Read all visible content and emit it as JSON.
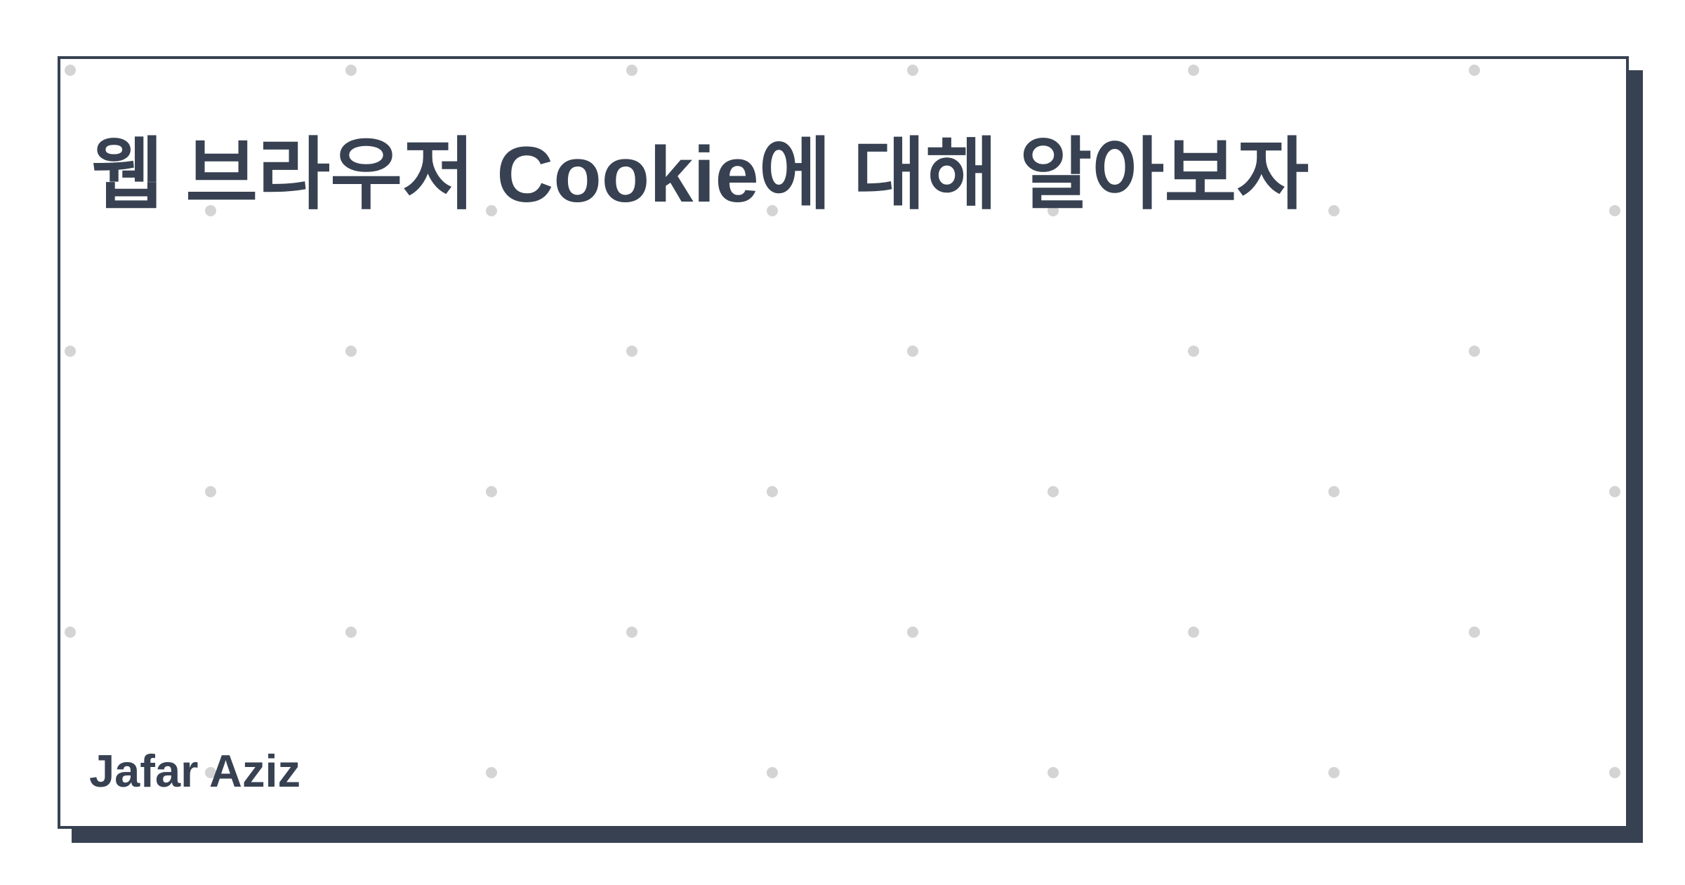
{
  "card": {
    "title": "웹 브라우저 Cookie에 대해 알아보자",
    "author": "Jafar Aziz"
  },
  "colors": {
    "text": "#374151",
    "border": "#374151",
    "shadow": "#374151",
    "dots": "#d4d4d4",
    "background": "#ffffff"
  }
}
